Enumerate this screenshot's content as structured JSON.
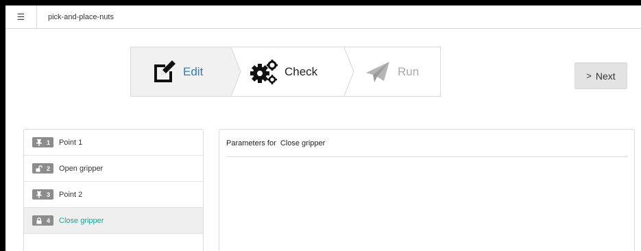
{
  "header": {
    "menu_icon": "hamburger-icon",
    "program_name": "pick-and-place-nuts"
  },
  "stepper": {
    "steps": [
      {
        "label": "Edit",
        "icon": "edit-icon",
        "state": "active",
        "color": "#2a7bc0"
      },
      {
        "label": "Check",
        "icon": "gears-icon",
        "state": "enabled",
        "color": "#222222"
      },
      {
        "label": "Run",
        "icon": "paper-plane-icon",
        "state": "disabled",
        "color": "#aaaaaa"
      }
    ]
  },
  "next_button": {
    "label": "Next",
    "arrow": ">"
  },
  "program_items": [
    {
      "number": "1",
      "icon": "pin-icon",
      "name": "Point 1",
      "selected": false
    },
    {
      "number": "2",
      "icon": "unlock-icon",
      "name": "Open gripper",
      "selected": false
    },
    {
      "number": "3",
      "icon": "pin-icon",
      "name": "Point 2",
      "selected": false
    },
    {
      "number": "4",
      "icon": "lock-icon",
      "name": "Close gripper",
      "selected": true
    }
  ],
  "parameters": {
    "header": "Parameters for  Close gripper"
  },
  "colors": {
    "accent": "#2a7bc0",
    "selected_text": "#1aa39a",
    "badge": "#8c8c8c"
  }
}
